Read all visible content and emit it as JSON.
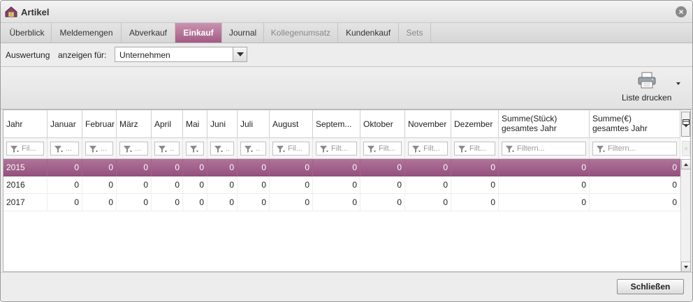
{
  "window": {
    "title": "Artikel",
    "close_icon": "close-icon",
    "app_icon": "article-icon"
  },
  "tabs": [
    {
      "label": "Überblick",
      "state": "normal"
    },
    {
      "label": "Meldemengen",
      "state": "normal"
    },
    {
      "label": "Abverkauf",
      "state": "normal"
    },
    {
      "label": "Einkauf",
      "state": "active"
    },
    {
      "label": "Journal",
      "state": "normal"
    },
    {
      "label": "Kollegenumsatz",
      "state": "disabled"
    },
    {
      "label": "Kundenkauf",
      "state": "normal"
    },
    {
      "label": "Sets",
      "state": "disabled"
    }
  ],
  "filterbar": {
    "label1": "Auswertung",
    "label2": "anzeigen für:",
    "select_value": "Unternehmen"
  },
  "toolbar": {
    "print_label": "Liste drucken",
    "print_icon": "printer-icon"
  },
  "grid": {
    "columns": [
      {
        "label": "Jahr",
        "filter": "Fil..."
      },
      {
        "label": "Januar",
        "filter": "..."
      },
      {
        "label": "Februar",
        "filter": "..."
      },
      {
        "label": "März",
        "filter": "..."
      },
      {
        "label": "April",
        "filter": ".."
      },
      {
        "label": "Mai",
        "filter": ""
      },
      {
        "label": "Juni",
        "filter": ".."
      },
      {
        "label": "Juli",
        "filter": ".."
      },
      {
        "label": "August",
        "filter": "Fil..."
      },
      {
        "label": "Septem...",
        "filter": "Filt..."
      },
      {
        "label": "Oktober",
        "filter": "Filt..."
      },
      {
        "label": "November",
        "filter": "Filt..."
      },
      {
        "label": "Dezember",
        "filter": "Filt..."
      },
      {
        "label_line1": "Summe(Stück)",
        "label_line2": "gesamtes Jahr",
        "filter": "Filtern..."
      },
      {
        "label_line1": "Summe(€)",
        "label_line2": "gesamtes Jahr",
        "filter": "Filtern..."
      }
    ],
    "rows": [
      {
        "selected": true,
        "cells": [
          "2015",
          "0",
          "0",
          "0",
          "0",
          "0",
          "0",
          "0",
          "0",
          "0",
          "0",
          "0",
          "0",
          "0",
          "0"
        ]
      },
      {
        "selected": false,
        "cells": [
          "2016",
          "0",
          "0",
          "0",
          "0",
          "0",
          "0",
          "0",
          "0",
          "0",
          "0",
          "0",
          "0",
          "0",
          "0"
        ]
      },
      {
        "selected": false,
        "cells": [
          "2017",
          "0",
          "0",
          "0",
          "0",
          "0",
          "0",
          "0",
          "0",
          "0",
          "0",
          "0",
          "0",
          "0",
          "0"
        ]
      }
    ],
    "selected_color": "#a45a84"
  },
  "footer": {
    "close_label": "Schließen"
  }
}
